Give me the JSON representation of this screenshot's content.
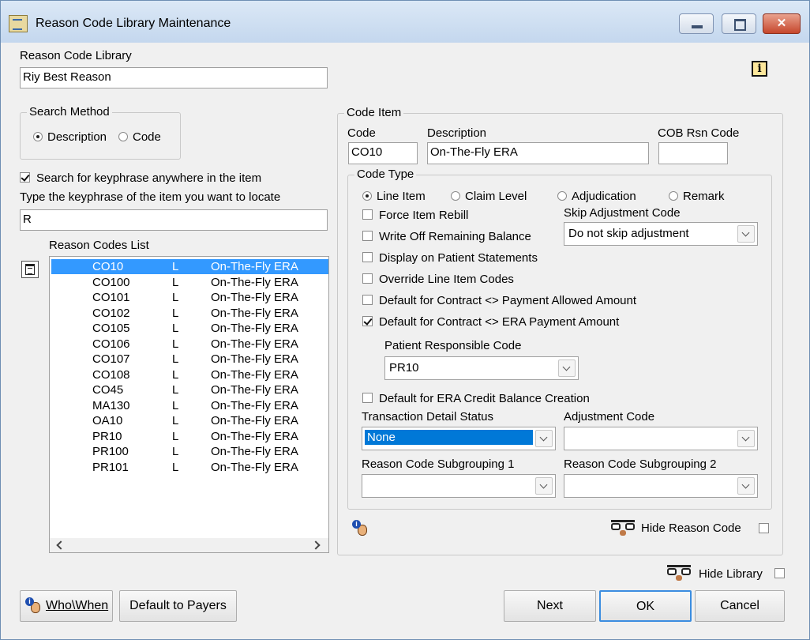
{
  "window": {
    "title": "Reason Code Library Maintenance",
    "close_glyph": "✕"
  },
  "library": {
    "label": "Reason Code Library",
    "value": "Riy Best Reason",
    "info_glyph": "i"
  },
  "search_method": {
    "legend": "Search Method",
    "options": [
      {
        "label": "Description",
        "selected": true
      },
      {
        "label": "Code",
        "selected": false
      }
    ]
  },
  "keyphrase": {
    "anywhere_label": "Search for keyphrase anywhere in the item",
    "anywhere_checked": true,
    "prompt": "Type the keyphrase of the item you want to locate",
    "value": "R"
  },
  "reason_codes": {
    "label": "Reason Codes List",
    "items": [
      {
        "code": "CO10",
        "type": "L",
        "desc": "On-The-Fly ERA"
      },
      {
        "code": "CO100",
        "type": "L",
        "desc": "On-The-Fly ERA"
      },
      {
        "code": "CO101",
        "type": "L",
        "desc": "On-The-Fly ERA"
      },
      {
        "code": "CO102",
        "type": "L",
        "desc": "On-The-Fly ERA"
      },
      {
        "code": "CO105",
        "type": "L",
        "desc": "On-The-Fly ERA"
      },
      {
        "code": "CO106",
        "type": "L",
        "desc": "On-The-Fly ERA"
      },
      {
        "code": "CO107",
        "type": "L",
        "desc": "On-The-Fly ERA"
      },
      {
        "code": "CO108",
        "type": "L",
        "desc": "On-The-Fly ERA"
      },
      {
        "code": "CO45",
        "type": "L",
        "desc": "On-The-Fly ERA"
      },
      {
        "code": "MA130",
        "type": "L",
        "desc": "On-The-Fly ERA"
      },
      {
        "code": "OA10",
        "type": "L",
        "desc": "On-The-Fly ERA"
      },
      {
        "code": "PR10",
        "type": "L",
        "desc": "On-The-Fly ERA"
      },
      {
        "code": "PR100",
        "type": "L",
        "desc": "On-The-Fly ERA"
      },
      {
        "code": "PR101",
        "type": "L",
        "desc": "On-The-Fly ERA"
      }
    ],
    "selected_index": 0
  },
  "code_item": {
    "legend": "Code Item",
    "code_label": "Code",
    "code_value": "CO10",
    "desc_label": "Description",
    "desc_value": "On-The-Fly ERA",
    "cob_label": "COB Rsn Code",
    "cob_value": ""
  },
  "code_type": {
    "legend": "Code Type",
    "options": [
      {
        "label": "Line Item",
        "selected": true
      },
      {
        "label": "Claim Level",
        "selected": false
      },
      {
        "label": "Adjudication",
        "selected": false
      },
      {
        "label": "Remark",
        "selected": false
      }
    ],
    "skip_label": "Skip Adjustment Code",
    "skip_value": "Do not skip adjustment",
    "checks": [
      {
        "label": "Force Item Rebill",
        "checked": false
      },
      {
        "label": "Write Off Remaining Balance",
        "checked": false
      },
      {
        "label": "Display on Patient Statements",
        "checked": false
      },
      {
        "label": "Override Line Item Codes",
        "checked": false
      },
      {
        "label": "Default for Contract <> Payment Allowed Amount",
        "checked": false
      },
      {
        "label": "Default for Contract <> ERA Payment Amount",
        "checked": true
      }
    ],
    "prc_label": "Patient Responsible Code",
    "prc_value": "PR10",
    "era_credit_label": "Default for ERA Credit Balance Creation",
    "era_credit_checked": false,
    "tds_label": "Transaction Detail Status",
    "tds_value": "None",
    "adj_label": "Adjustment Code",
    "adj_value": "",
    "sub1_label": "Reason Code Subgrouping 1",
    "sub1_value": "",
    "sub2_label": "Reason Code Subgrouping 2",
    "sub2_value": ""
  },
  "hide_reason": {
    "label": "Hide Reason Code",
    "checked": false
  },
  "hide_library": {
    "label": "Hide Library",
    "checked": false
  },
  "buttons": {
    "whowhen": "Who\\When",
    "default_payers": "Default to Payers",
    "next": "Next",
    "ok": "OK",
    "cancel": "Cancel"
  }
}
